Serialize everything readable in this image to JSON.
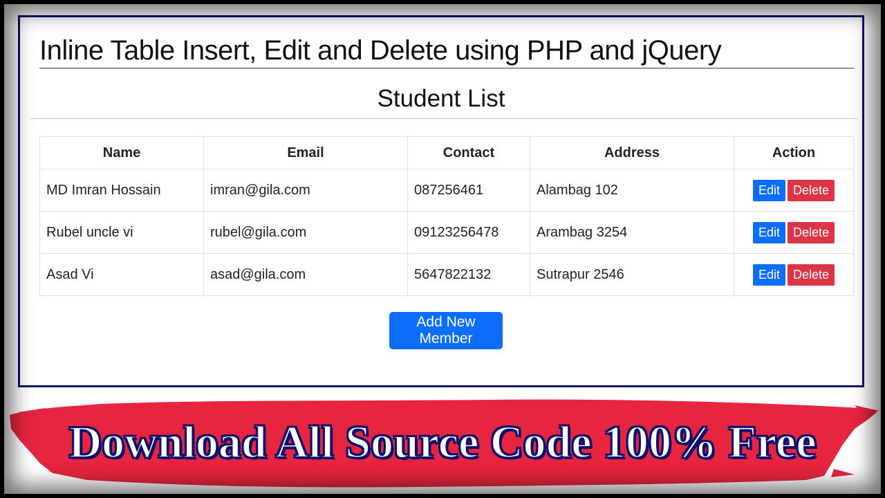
{
  "page": {
    "title": "Inline Table Insert, Edit and Delete using PHP and jQuery",
    "subtitle": "Student List"
  },
  "table": {
    "headers": [
      "Name",
      "Email",
      "Contact",
      "Address",
      "Action"
    ],
    "rows": [
      {
        "name": "MD Imran Hossain",
        "email": "imran@gila.com",
        "contact": "087256461",
        "address": "Alambag 102"
      },
      {
        "name": "Rubel uncle vi",
        "email": "rubel@gila.com",
        "contact": "09123256478",
        "address": "Arambag 3254"
      },
      {
        "name": "Asad Vi",
        "email": "asad@gila.com",
        "contact": "5647822132",
        "address": "Sutrapur 2546"
      }
    ],
    "edit_label": "Edit",
    "delete_label": "Delete"
  },
  "add_button": "Add New Member",
  "banner": {
    "text": "Download All Source Code 100% Free"
  },
  "colors": {
    "primary": "#0d6efd",
    "danger": "#dc3545",
    "panel_border": "#0d0f6e",
    "banner_red": "#e8253f"
  }
}
